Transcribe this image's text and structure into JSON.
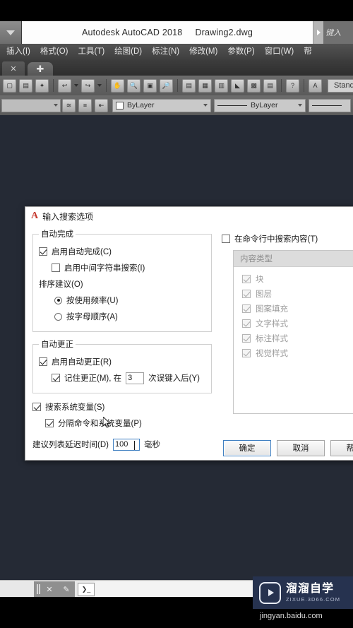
{
  "app": {
    "title": "Autodesk AutoCAD 2018",
    "document": "Drawing2.dwg",
    "search_placeholder": "键入",
    "qat_icon": "dropdown-arrow-icon"
  },
  "menubar": {
    "items": [
      {
        "label": "插入(I)"
      },
      {
        "label": "格式(O)"
      },
      {
        "label": "工具(T)"
      },
      {
        "label": "绘图(D)"
      },
      {
        "label": "标注(N)"
      },
      {
        "label": "修改(M)"
      },
      {
        "label": "参数(P)"
      },
      {
        "label": "窗口(W)"
      },
      {
        "label": "帮"
      }
    ]
  },
  "tabstrip": {
    "close_label": "✕",
    "new_tab_label": "✚"
  },
  "toolbar": {
    "text_style": "Standard",
    "icons": [
      "new-file-icon",
      "save-icon",
      "plot-icon",
      "undo-icon",
      "redo-icon",
      "pan-icon",
      "zoom-icon",
      "zoom-window-icon",
      "zoom-previous-icon",
      "properties-icon",
      "design-center-icon",
      "tool-palettes-icon",
      "layer-tools-icon",
      "sheet-set-icon",
      "calculator-icon",
      "help-icon",
      "text-style-icon"
    ]
  },
  "properties_bar": {
    "layer_dropdown": "",
    "color_value": "ByLayer",
    "linetype_value": "ByLayer",
    "layer_icons": [
      "layer-properties-icon",
      "layer-state-icon",
      "layer-previous-icon"
    ]
  },
  "dialog": {
    "title": "输入搜索选项",
    "logo": "autocad-a-icon",
    "autocomplete": {
      "legend": "自动完成",
      "enable": {
        "label": "启用自动完成(C)",
        "checked": true
      },
      "midstring": {
        "label": "启用中间字符串搜索(I)",
        "checked": false
      },
      "sort_label": "排序建议(O)",
      "sort_options": [
        {
          "label": "按使用频率(U)",
          "selected": true
        },
        {
          "label": "按字母顺序(A)",
          "selected": false
        }
      ]
    },
    "autocorrect": {
      "legend": "自动更正",
      "enable": {
        "label": "启用自动更正(R)",
        "checked": true
      },
      "remember": {
        "label_before": "记住更正(M), 在",
        "value": "3",
        "label_after": "次误键入后(Y)",
        "checked": true
      }
    },
    "sysvar": {
      "search": {
        "label": "搜索系统变量(S)",
        "checked": true
      },
      "separate": {
        "label": "分隔命令和系统变量(P)",
        "checked": true
      }
    },
    "delay": {
      "label": "建议列表延迟时间(D)",
      "value": "100",
      "unit": "毫秒"
    },
    "content_search": {
      "label": "在命令行中搜索内容(T)",
      "checked": false
    },
    "content_types": {
      "header": "内容类型",
      "items": [
        {
          "label": "块",
          "checked": true,
          "disabled": true
        },
        {
          "label": "图层",
          "checked": true,
          "disabled": true
        },
        {
          "label": "图案填充",
          "checked": true,
          "disabled": true
        },
        {
          "label": "文字样式",
          "checked": true,
          "disabled": true
        },
        {
          "label": "标注样式",
          "checked": true,
          "disabled": true
        },
        {
          "label": "视觉样式",
          "checked": true,
          "disabled": true
        }
      ]
    },
    "buttons": {
      "ok": "确定",
      "cancel": "取消",
      "help": "帮助"
    }
  },
  "statusbar": {
    "close_label": "✕",
    "wrench_label": "✎",
    "prompt_label": "❯_"
  },
  "watermark": {
    "brand_cn": "溜溜自学",
    "brand_en": "ZIXUE.3D66.COM",
    "credit": "jingyan.baidu.com",
    "logo": "play-button-icon",
    "bg_color": "#26324f"
  },
  "colors": {
    "canvas": "#252a35",
    "accent": "#3f7fc1",
    "autocad_red": "#c5392f"
  }
}
